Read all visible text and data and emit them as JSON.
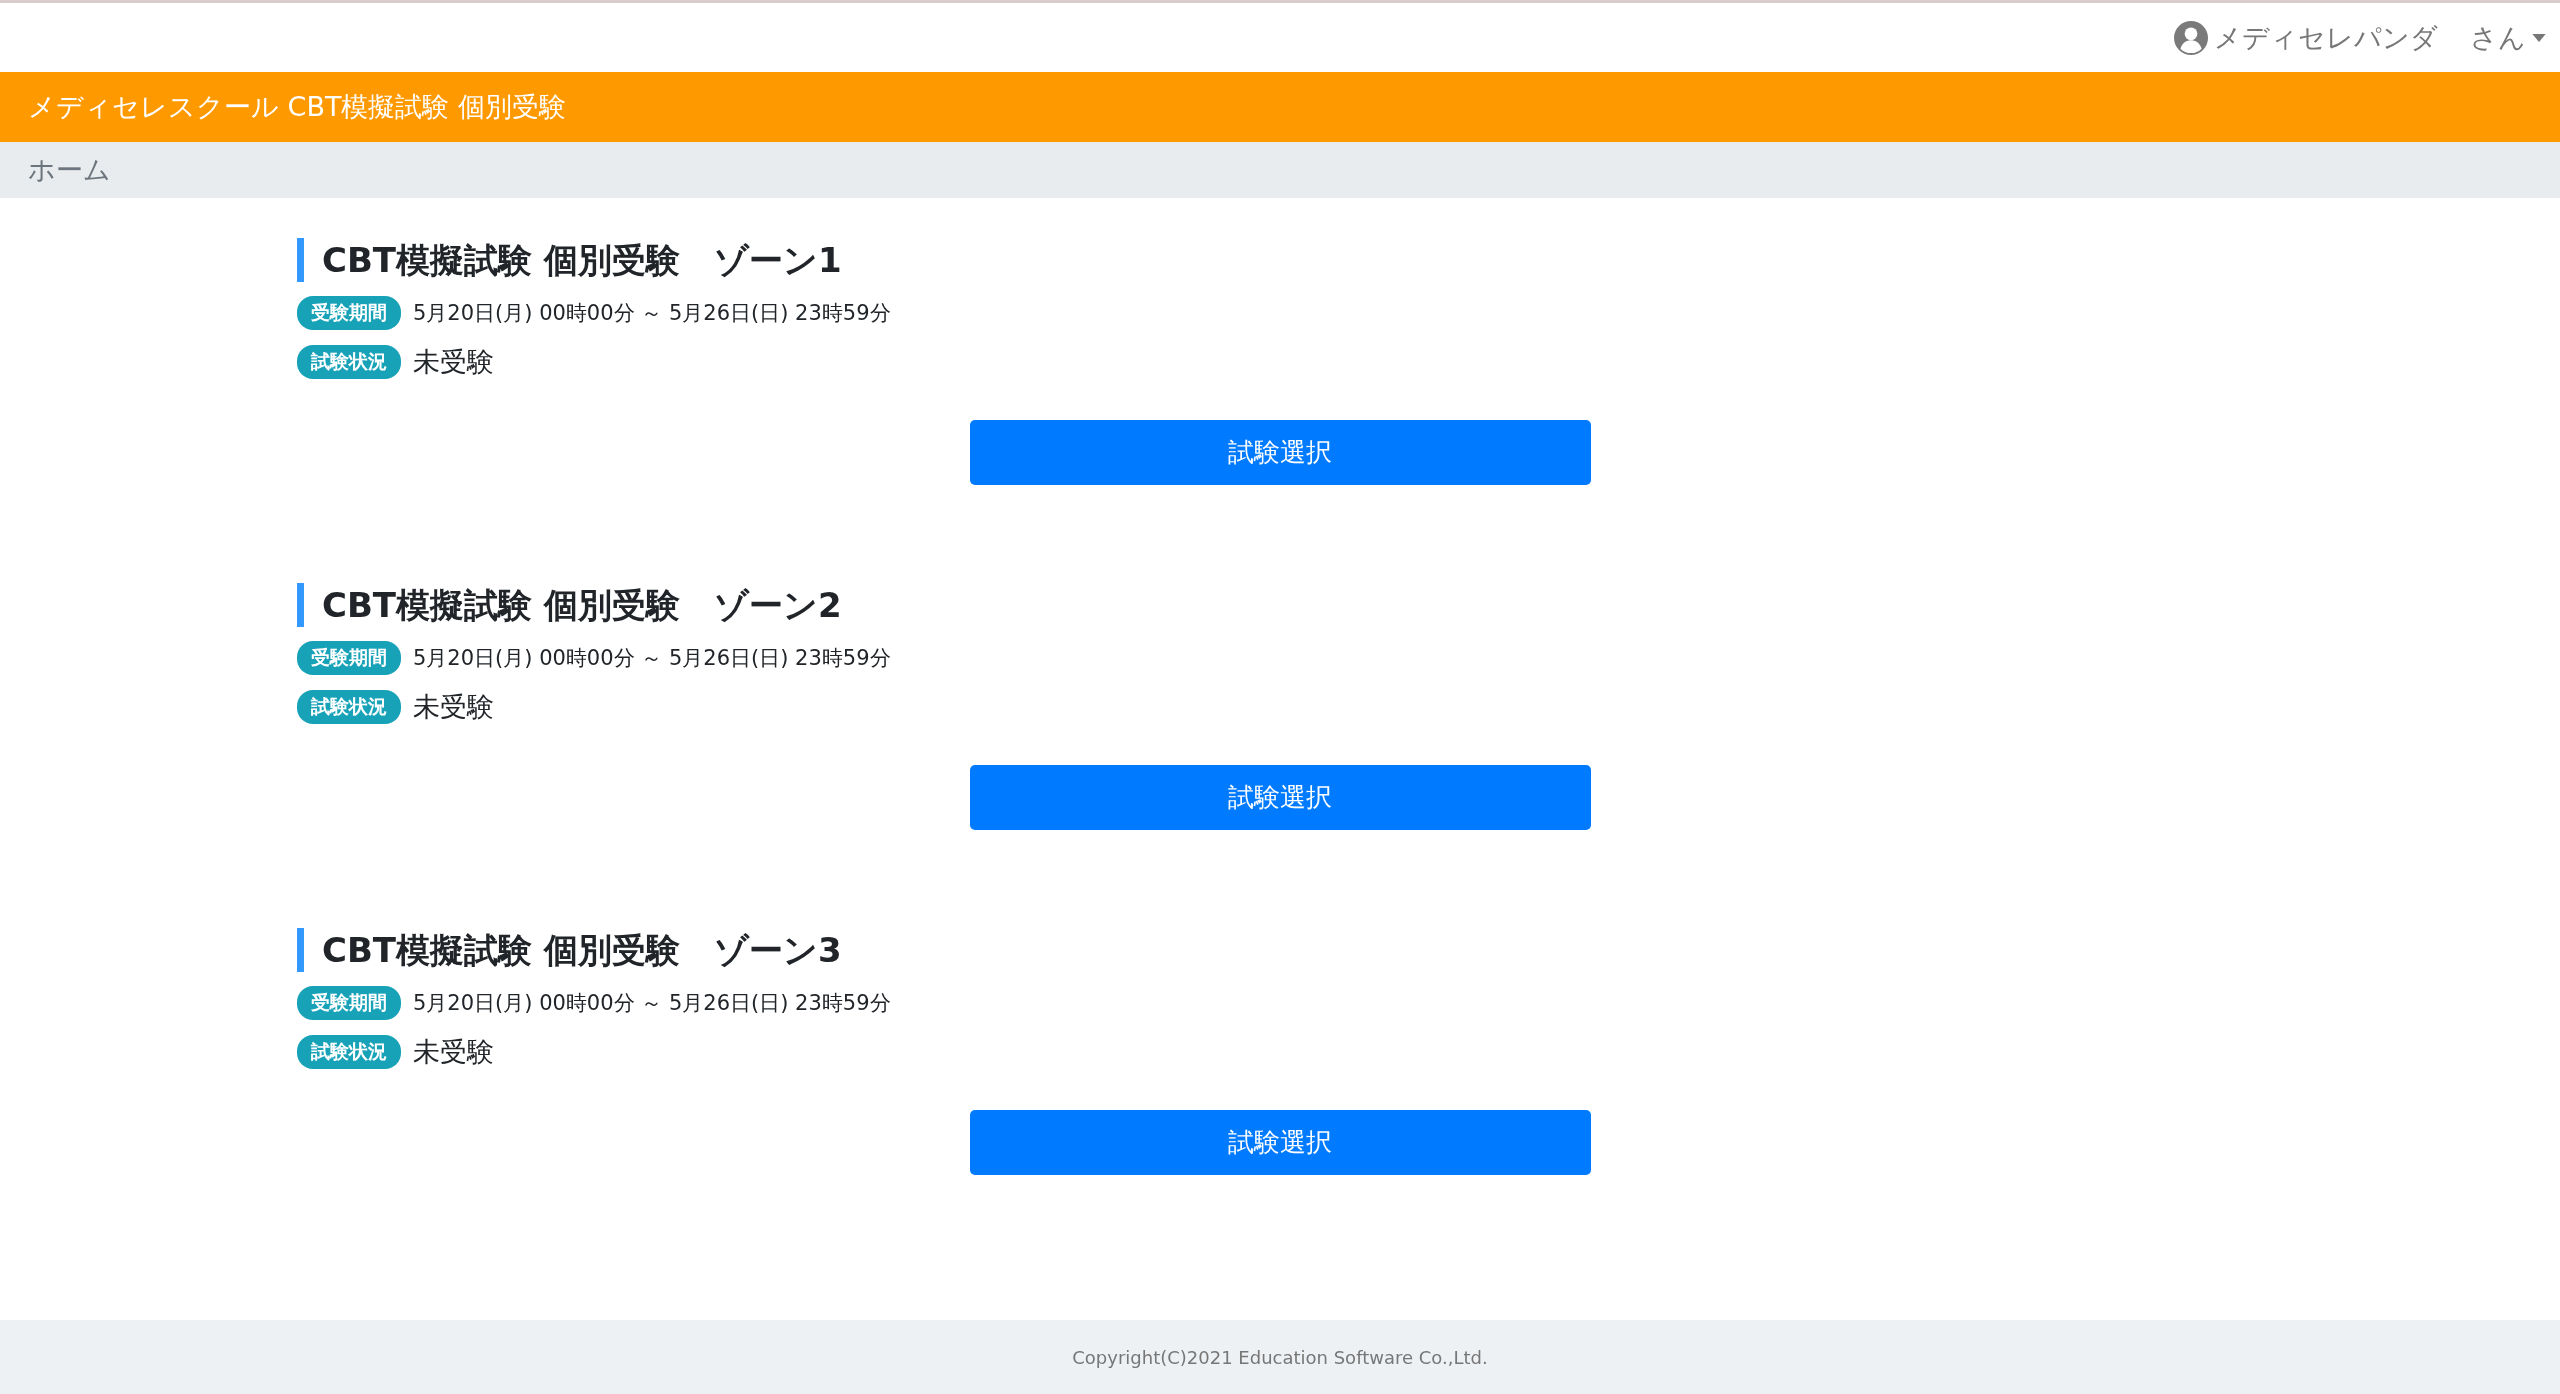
{
  "user_menu": {
    "name": "メディセレパンダ",
    "suffix": "さん"
  },
  "header": {
    "title": "メディセレスクール CBT模擬試験 個別受験"
  },
  "breadcrumb": [
    "ホーム"
  ],
  "exams": [
    {
      "title": "CBT模擬試験 個別受験　ゾーン1",
      "period_label": "受験期間",
      "period": "5月20日(月) 00時00分 ～ 5月26日(日) 23時59分",
      "status_label": "試験状況",
      "status": "未受験",
      "button": "試験選択"
    },
    {
      "title": "CBT模擬試験 個別受験　ゾーン2",
      "period_label": "受験期間",
      "period": "5月20日(月) 00時00分 ～ 5月26日(日) 23時59分",
      "status_label": "試験状況",
      "status": "未受験",
      "button": "試験選択"
    },
    {
      "title": "CBT模擬試験 個別受験　ゾーン3",
      "period_label": "受験期間",
      "period": "5月20日(月) 00時00分 ～ 5月26日(日) 23時59分",
      "status_label": "試験状況",
      "status": "未受験",
      "button": "試験選択"
    }
  ],
  "footer": "Copyright(C)2021 Education Software Co.,Ltd."
}
